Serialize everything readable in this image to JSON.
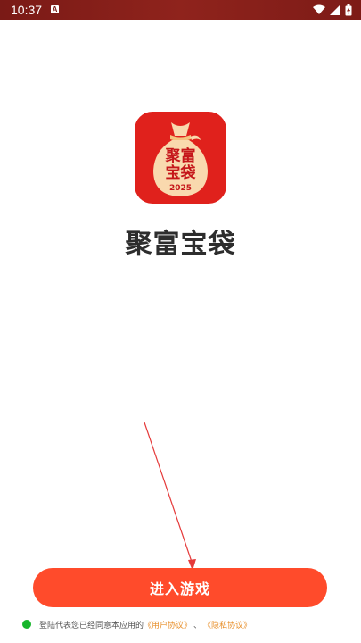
{
  "status_bar": {
    "time": "10:37",
    "notification_letter": "A",
    "icons": [
      "wifi-icon",
      "signal-icon",
      "battery-charging-icon"
    ]
  },
  "app": {
    "name": "聚富宝袋",
    "icon_text": {
      "line1": "聚富",
      "line2": "宝袋",
      "year": "2025"
    },
    "icon_colors": {
      "background": "#e0211c",
      "bag": "#f9d9ae",
      "text": "#c5161a"
    }
  },
  "enter_button": {
    "label": "进入游戏",
    "color": "#ff4b2b"
  },
  "agreement": {
    "prefix": "登陆代表您已经同意本应用的",
    "user_agreement": "《用户协议》",
    "separator": "、",
    "privacy_policy": "《隐私协议》",
    "dot_color": "#16b52a",
    "link_color": "#e8902c"
  }
}
